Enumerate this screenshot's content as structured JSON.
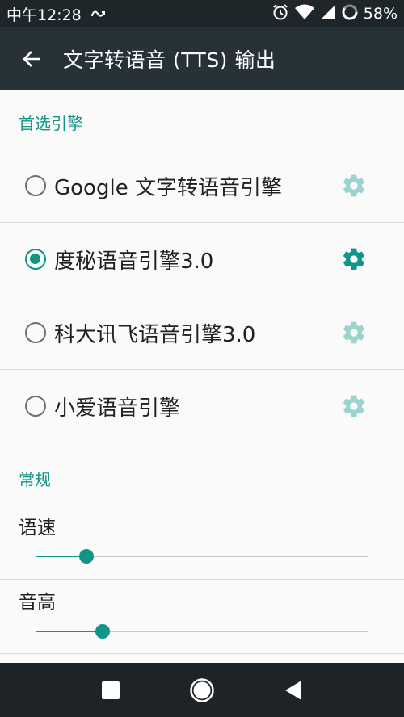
{
  "status_bar": {
    "time": "中午12:28",
    "battery_percent": "58%",
    "icons": [
      "link-icon",
      "alarm-icon",
      "wifi-icon",
      "signal-icon",
      "battery-icon"
    ]
  },
  "app_bar": {
    "back_icon": "arrow-back-icon",
    "title": "文字转语音 (TTS) 输出"
  },
  "preferred_engine": {
    "header": "首选引擎",
    "engines": [
      {
        "label": "Google 文字转语音引擎",
        "selected": false,
        "settings_enabled": false
      },
      {
        "label": "度秘语音引擎3.0",
        "selected": true,
        "settings_enabled": true
      },
      {
        "label": "科大讯飞语音引擎3.0",
        "selected": false,
        "settings_enabled": false
      },
      {
        "label": "小爱语音引擎",
        "selected": false,
        "settings_enabled": false
      }
    ]
  },
  "general": {
    "header": "常规",
    "sliders": [
      {
        "label": "语速",
        "level": 0.15
      },
      {
        "label": "音高",
        "level": 0.2
      }
    ]
  },
  "nav_bar": {
    "icons": [
      "recents-icon",
      "home-icon",
      "back-icon"
    ]
  },
  "colors": {
    "accent": "#109586",
    "accent_disabled": "#9bd3ce",
    "app_bar": "#263238",
    "status_bar": "#1f2629",
    "nav_bar": "#1d2326"
  }
}
